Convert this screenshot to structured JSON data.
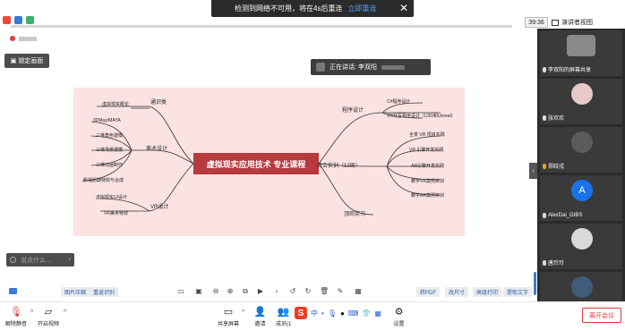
{
  "notice": {
    "text": "检测到网络不可用，将在4s后重连",
    "action": "立即重连"
  },
  "header": {
    "clock": "39:36",
    "view_label": "演讲者视图"
  },
  "lock_screen_label": "锁定画面",
  "speaker_label": "正在讲话: 李双阳",
  "chat_placeholder": "说点什么...",
  "mindmap": {
    "center": "虚拟现实应用技术  专业课程",
    "branches": [
      {
        "label": "通识类",
        "children": [
          "虚拟现实概论"
        ]
      },
      {
        "label": "美术设计",
        "children": [
          "3DMay/MAYA",
          "三维角色建模",
          "三维场景建模",
          "三维动画制作",
          "影视后期特效与合成"
        ]
      },
      {
        "label": "VR设计",
        "children": [
          "虚拟现实UI设计",
          "VR美术特效"
        ]
      },
      {
        "label": "程序设计",
        "children": [
          "C#程序设计",
          "VR交互程序设计（U3D和Unreal）"
        ]
      },
      {
        "label": "综合实训（12周）",
        "children": [
          "全景 VR 项目实践",
          "VR 引擎开发实践",
          "AR引擎开发实践",
          "教学VR案例实训",
          "教学AR案例实训"
        ]
      },
      {
        "label": "顶岗实习",
        "children": []
      }
    ]
  },
  "doc_toolbar": {
    "pills_left": [
      "图片压缩",
      "重返识别"
    ],
    "pills_right": [
      "转PDF",
      "改尺寸",
      "高级打印",
      "提取文字"
    ]
  },
  "bottom_bar": {
    "mute_label": "解除静音",
    "video_label": "开启视频",
    "share_label": "共享屏幕",
    "invite_label": "邀请",
    "members_label": "成员(1",
    "settings_label": "设置",
    "leave_label": "离开会议",
    "ime_glyph": "S",
    "ime_chinese": "中"
  },
  "participants": [
    {
      "name": "李双阳的屏幕共享",
      "avatar_color": "#8a8a8a",
      "avatar_text": ""
    },
    {
      "name": "张欢欢",
      "avatar_color": "#e7c9c9",
      "avatar_text": ""
    },
    {
      "name": "郑晓戎",
      "avatar_color": "#5b5b5b",
      "avatar_text": ""
    },
    {
      "name": "AlexDai_GIBS",
      "avatar_color": "#1a73e8",
      "avatar_text": "A"
    },
    {
      "name": "唐玲玲",
      "avatar_color": "#d9d9d9",
      "avatar_text": ""
    },
    {
      "name": "",
      "avatar_color": "#3f5c7a",
      "avatar_text": ""
    }
  ],
  "colors": {
    "accent_red": "#b63a3e",
    "slide_bg": "#fbe3e3",
    "link_blue": "#2b5ea8",
    "leave_red": "#e03a3a"
  }
}
